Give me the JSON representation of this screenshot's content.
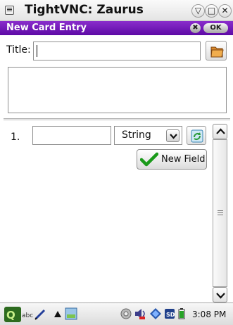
{
  "window": {
    "title": "TightVNC: Zaurus",
    "controls": [
      "▽",
      "□",
      "✕"
    ]
  },
  "dialog": {
    "title": "New Card Entry",
    "close_label": "✖",
    "ok_label": "OK"
  },
  "form": {
    "title_label": "Title:",
    "title_value": "",
    "field_number": "1.",
    "field_value": "",
    "field_type": "String",
    "new_field_label": "New Field"
  },
  "taskbar": {
    "input_mode": "abc",
    "clock": "3:08 PM"
  }
}
